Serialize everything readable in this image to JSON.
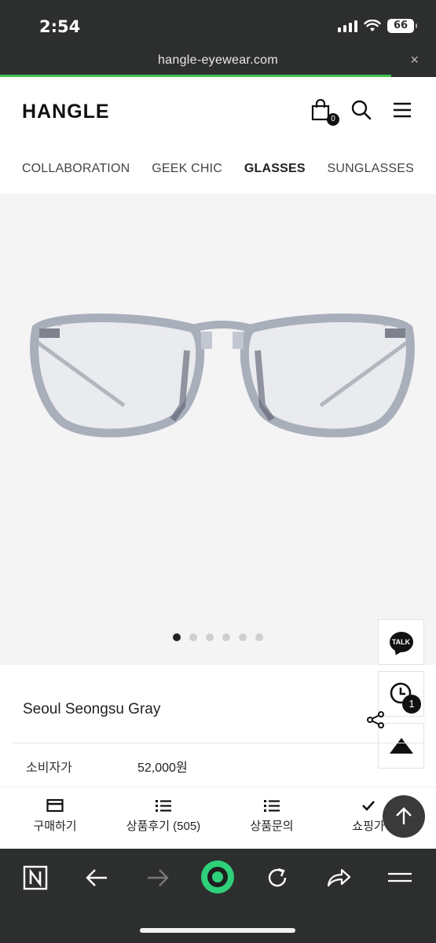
{
  "status_bar": {
    "time": "2:54",
    "battery": "66"
  },
  "browser": {
    "url": "hangle-eyewear.com",
    "close_label": "×"
  },
  "header": {
    "logo": "HANGLE",
    "cart_count": "0"
  },
  "categories": [
    {
      "label": "COLLABORATION",
      "active": false
    },
    {
      "label": "GEEK CHIC",
      "active": false
    },
    {
      "label": "GLASSES",
      "active": true
    },
    {
      "label": "SUNGLASSES",
      "active": false
    }
  ],
  "gallery": {
    "total_images": 6,
    "current_image": 1
  },
  "floating": {
    "talk_label": "TALK",
    "recent_count": "1"
  },
  "product": {
    "name": "Seoul Seongsu Gray",
    "price_label": "소비자가",
    "price_value": "52,000원"
  },
  "tabs": [
    {
      "label": "구매하기",
      "icon": "card-icon"
    },
    {
      "label": "상품후기 (505)",
      "icon": "list-icon"
    },
    {
      "label": "상품문의",
      "icon": "list-icon"
    },
    {
      "label": "쇼핑가",
      "icon": "check-icon"
    }
  ],
  "colors": {
    "dark_bar": "#2d2f2e",
    "progress": "#3fbf4d",
    "gallery_bg": "#f4f4f5",
    "accent_dark": "#111111"
  }
}
